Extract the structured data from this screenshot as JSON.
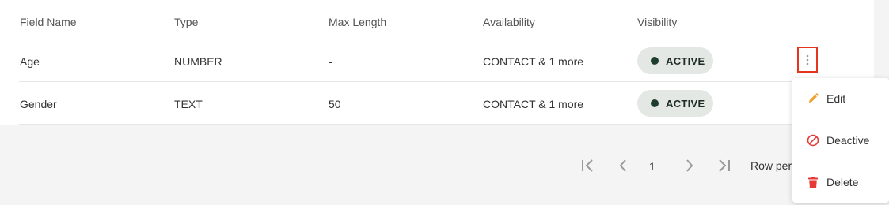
{
  "table": {
    "headers": [
      "Field Name",
      "Type",
      "Max Length",
      "Availability",
      "Visibility"
    ],
    "rows": [
      {
        "field_name": "Age",
        "type": "NUMBER",
        "max_length": "-",
        "availability": "CONTACT & 1 more",
        "visibility": "ACTIVE"
      },
      {
        "field_name": "Gender",
        "type": "TEXT",
        "max_length": "50",
        "availability": "CONTACT & 1 more",
        "visibility": "ACTIVE"
      }
    ]
  },
  "pagination": {
    "current_page": "1",
    "rows_per_page_label": "Row per"
  },
  "context_menu": {
    "items": [
      {
        "label": "Edit",
        "icon": "pencil-icon",
        "color": "#f0a030"
      },
      {
        "label": "Deactive",
        "icon": "ban-icon",
        "color": "#e53935"
      },
      {
        "label": "Delete",
        "icon": "trash-icon",
        "color": "#e53935"
      }
    ]
  },
  "colors": {
    "badge_bg": "#e4e8e5",
    "badge_dot": "#1f3d2b",
    "highlight_border": "#e8341c"
  }
}
